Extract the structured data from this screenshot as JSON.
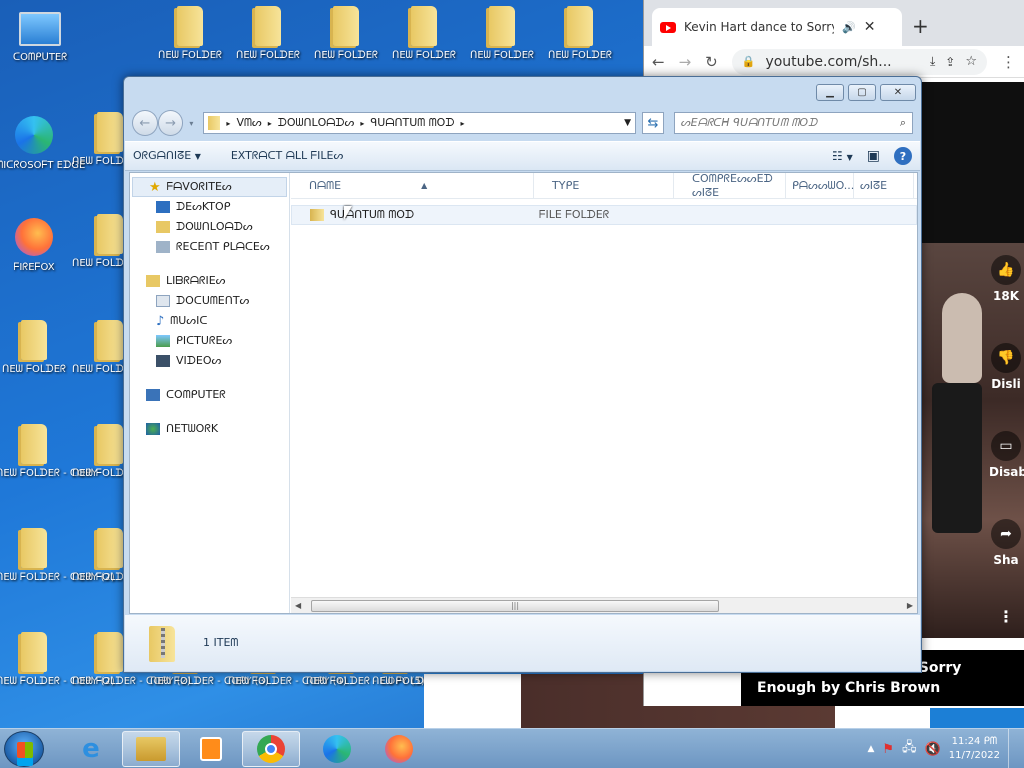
{
  "desktop": {
    "icons": [
      {
        "label": "ᑕOᗰᑭᑌTEᖇ",
        "kind": "computer"
      },
      {
        "label": "ᑎEᗯ ᖴOᒪᗪEᖇ",
        "kind": "folder"
      },
      {
        "label": "ᑎEᗯ ᖴOᒪᗪEᖇ",
        "kind": "folder"
      },
      {
        "label": "ᑎEᗯ ᖴOᒪᗪEᖇ",
        "kind": "folder"
      },
      {
        "label": "ᑎEᗯ ᖴOᒪᗪEᖇ",
        "kind": "folder"
      },
      {
        "label": "ᑎEᗯ ᖴOᒪᗪEᖇ",
        "kind": "folder"
      },
      {
        "label": "ᑎEᗯ ᖴOᒪᗪEᖇ",
        "kind": "folder"
      },
      {
        "label": "ᗰIᑕᖇOSOᖴT EᗪGE",
        "kind": "edge"
      },
      {
        "label": "ᑎEᗯ ᖴOᒪᗪEᖇ - ᑕOᑭY",
        "kind": "folder"
      },
      {
        "label": "ᖴIᖇEᖴOX",
        "kind": "firefox"
      },
      {
        "label": "ᑎEᗯ ᖴOᒪᗪEᖇ - ᑕOᑭY",
        "kind": "folder"
      },
      {
        "label": "ᑎEᗯ ᖴOᒪᗪEᖇ",
        "kind": "folder"
      },
      {
        "label": "ᑎEᗯ ᖴOᒪᗪEᖇ - ᑕOᑭY",
        "kind": "folder"
      },
      {
        "label": "ᑎEᗯ ᖴOᒪᗪEᖇ - ᑕOᑭY",
        "kind": "folder"
      },
      {
        "label": "ᑎEᗯ ᖴOᒪᗪEᖇ - ᑕOᑭY",
        "kind": "folder"
      },
      {
        "label": "ᑎEᗯ ᖴOᒪᗪEᖇ - ᑕOᑭY (2)",
        "kind": "folder"
      },
      {
        "label": "ᑎEᗯ ᖴOᒪᗪEᖇ - ᑕOᑭY",
        "kind": "folder"
      },
      {
        "label": "ᑎEᗯ ᖴOᒪᗪEᖇ - ᑕOᑭY (2)",
        "kind": "folder"
      },
      {
        "label": "ᑎEᗯ ᖴOᒪᗪEᖇ - ᑕOᑭY (2)",
        "kind": "folder"
      },
      {
        "label": "ᑎEᗯ ᖴOᒪᗪEᖇ - ᑕOᑭY (3)",
        "kind": "folder"
      },
      {
        "label": "ᑎEᗯ ᖴOᒪᗪEᖇ - ᑕOᑭY (4)",
        "kind": "folder"
      },
      {
        "label": "ᑎEᗯ ᖴOᒪᗪEᖇ - ᑕOᑭY (5)",
        "kind": "folder"
      },
      {
        "label": "ᑎEᗯ ᖴOᒪᗪEᖇ - ᑕOᑭY",
        "kind": "folder"
      }
    ]
  },
  "browser": {
    "tab_title": "Kevin Hart dance to Sorry Enough",
    "url": "youtube.com/sh...",
    "side_buttons": {
      "likes": "18K",
      "dislike": "Disli",
      "disable": "Disab",
      "share": "Sha"
    },
    "caption": "Kevin Hart dance to Sorry Enough by Chris Brown"
  },
  "explorer": {
    "breadcrumb": [
      "ᐯᗰᔕ",
      "ᗪOᗯᑎᒪOᗩᗪᔕ",
      "ᑫᑌᗩᑎTᑌᗰ ᗰOᗪ"
    ],
    "search_placeholder": "ᔕEᗩᖇᑕᕼ ᑫᑌᗩᑎTᑌᗰ ᗰOᗪ",
    "toolbar": {
      "organize": "OᖇGᗩᑎIᘔE",
      "extract": "EXTᖇᗩᑕT ᗩᒪᒪ ᖴIᒪEᔕ"
    },
    "nav": {
      "favorites_header": "ᖴᗩᐯOᖇITEᔕ",
      "favorites": [
        "ᗪEᔕKTOᑭ",
        "ᗪOᗯᑎᒪOᗩᗪᔕ",
        "ᖇEᑕEᑎT ᑭᒪᗩᑕEᔕ"
      ],
      "libraries_header": "ᒪIᗷᖇᗩᖇIEᔕ",
      "libraries": [
        "ᗪOᑕᑌᗰEᑎTᔕ",
        "ᗰᑌᔕIᑕ",
        "ᑭIᑕTᑌᖇEᔕ",
        "ᐯIᗪEOᔕ"
      ],
      "computer": "ᑕOᗰᑭᑌTEᖇ",
      "network": "ᑎETᗯOᖇK"
    },
    "columns": {
      "name": "ᑎᗩᗰE",
      "type": "TYᑭE",
      "compressed_size": "ᑕOᗰᑭᖇEᔕᔕEᗪ ᔕIᘔE",
      "password": "ᑭᗩᔕᔕᗯO...",
      "size": "ᔕIᘔE"
    },
    "rows": [
      {
        "name": "ᑫᑌᗩᑎTᑌᗰ ᗰOᗪ",
        "type": "ᖴIᒪE ᖴOᒪᗪEᖇ"
      }
    ],
    "status": "1 ITEᗰ"
  },
  "taskbar": {
    "clock_time": "11:24 ᑭᗰ",
    "clock_date": "11/7/2022"
  }
}
